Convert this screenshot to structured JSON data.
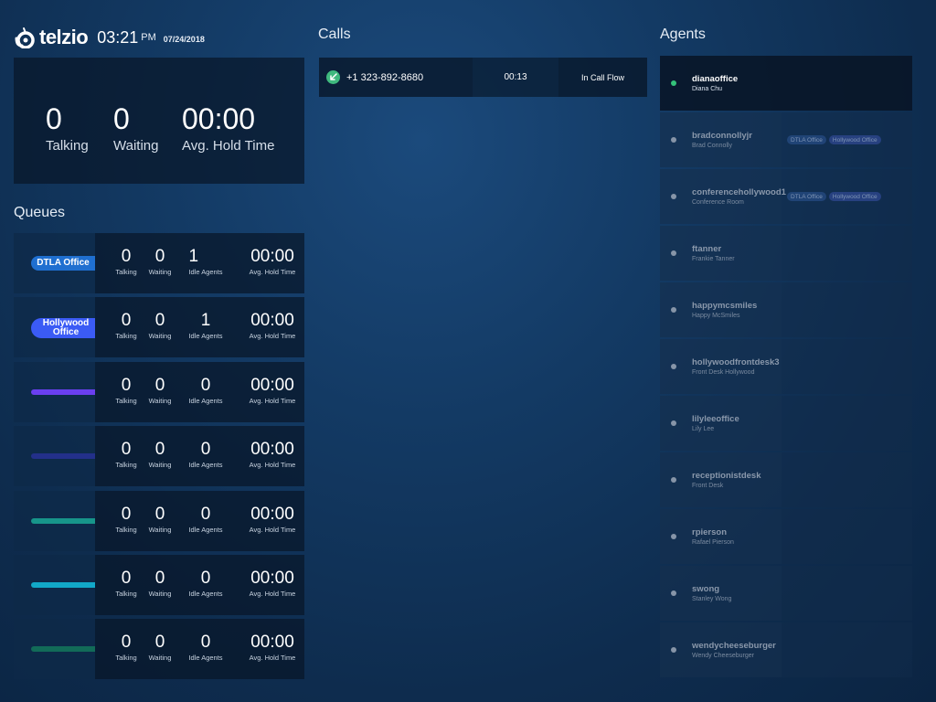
{
  "header": {
    "brand": "telzio",
    "time": "03:21",
    "ampm": "PM",
    "date": "07/24/2018"
  },
  "summary": {
    "talking": {
      "value": "0",
      "label": "Talking"
    },
    "waiting": {
      "value": "0",
      "label": "Waiting"
    },
    "hold": {
      "value": "00:00",
      "label": "Avg. Hold Time"
    }
  },
  "queues_title": "Queues",
  "queue_labels": {
    "talking": "Talking",
    "waiting": "Waiting",
    "idle": "Idle Agents",
    "hold": "Avg. Hold Time"
  },
  "queues": [
    {
      "name": "DTLA Office",
      "color": "#1f6fd0",
      "talking": "0",
      "waiting": "0",
      "idle": "1",
      "hold": "00:00"
    },
    {
      "name": "Hollywood Office",
      "color": "#3b5bf5",
      "talking": "0",
      "waiting": "0",
      "idle": "1",
      "hold": "00:00"
    },
    {
      "name": "",
      "color": "#6a3ff0",
      "talking": "0",
      "waiting": "0",
      "idle": "0",
      "hold": "00:00"
    },
    {
      "name": "",
      "color": "#23308a",
      "talking": "0",
      "waiting": "0",
      "idle": "0",
      "hold": "00:00"
    },
    {
      "name": "",
      "color": "#17958a",
      "talking": "0",
      "waiting": "0",
      "idle": "0",
      "hold": "00:00"
    },
    {
      "name": "",
      "color": "#12a8c8",
      "talking": "0",
      "waiting": "0",
      "idle": "0",
      "hold": "00:00"
    },
    {
      "name": "",
      "color": "#126b58",
      "talking": "0",
      "waiting": "0",
      "idle": "0",
      "hold": "00:00"
    }
  ],
  "calls_title": "Calls",
  "calls": [
    {
      "icon": "inbound-call-icon",
      "number": "+1 323-892-8680",
      "duration": "00:13",
      "status": "In Call Flow"
    }
  ],
  "agents_title": "Agents",
  "agents": [
    {
      "username": "dianaoffice",
      "name": "Diana Chu",
      "status": "online",
      "tags": []
    },
    {
      "username": "bradconnollyjr",
      "name": "Brad Connolly",
      "status": "offline",
      "tags": [
        "DTLA Office",
        "Hollywood Office"
      ]
    },
    {
      "username": "conferencehollywood1",
      "name": "Conference Room",
      "status": "offline",
      "tags": [
        "DTLA Office",
        "Hollywood Office"
      ]
    },
    {
      "username": "ftanner",
      "name": "Frankie Tanner",
      "status": "offline",
      "tags": []
    },
    {
      "username": "happymcsmiles",
      "name": "Happy McSmiles",
      "status": "offline",
      "tags": []
    },
    {
      "username": "hollywoodfrontdesk3",
      "name": "Front Desk Hollywood",
      "status": "offline",
      "tags": []
    },
    {
      "username": "lilyleeoffice",
      "name": "Lily Lee",
      "status": "offline",
      "tags": []
    },
    {
      "username": "receptionistdesk",
      "name": "Front Desk",
      "status": "offline",
      "tags": []
    },
    {
      "username": "rpierson",
      "name": "Rafael Pierson",
      "status": "offline",
      "tags": []
    },
    {
      "username": "swong",
      "name": "Stanley Wong",
      "status": "offline",
      "tags": []
    },
    {
      "username": "wendycheeseburger",
      "name": "Wendy Cheeseburger",
      "status": "offline",
      "tags": []
    }
  ]
}
